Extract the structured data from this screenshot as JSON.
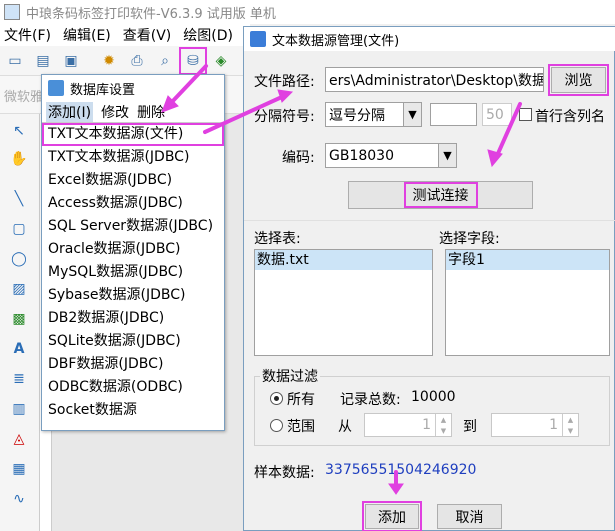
{
  "app": {
    "title": "中琅条码标签打印软件-V6.3.9 试用版 单机"
  },
  "menu": [
    "文件(F)",
    "编辑(E)",
    "查看(V)",
    "绘图(D)"
  ],
  "toolbar_hint": "微软雅",
  "db_settings": {
    "title": "数据库设置",
    "tabs": [
      "添加(I)",
      "修改",
      "删除"
    ],
    "items": [
      "TXT文本数据源(文件)",
      "TXT文本数据源(JDBC)",
      "Excel数据源(JDBC)",
      "Access数据源(JDBC)",
      "SQL Server数据源(JDBC)",
      "Oracle数据源(JDBC)",
      "MySQL数据源(JDBC)",
      "Sybase数据源(JDBC)",
      "DB2数据源(JDBC)",
      "SQLite数据源(JDBC)",
      "DBF数据源(JDBC)",
      "ODBC数据源(ODBC)",
      "Socket数据源"
    ],
    "selected_index": 0
  },
  "dialog": {
    "title": "文本数据源管理(文件)",
    "file_path_label": "文件路径:",
    "file_path_value": "ers\\Administrator\\Desktop\\数据.txt",
    "browse_label": "浏览",
    "separator_label": "分隔符号:",
    "separator_value": "逗号分隔",
    "separator_custom": "",
    "separator_num": "50",
    "first_row_label": "首行含列名",
    "encoding_label": "编码:",
    "encoding_value": "GB18030",
    "test_label": "测试连接",
    "select_table_label": "选择表:",
    "tables": [
      "数据.txt"
    ],
    "select_field_label": "选择字段:",
    "fields": [
      "字段1"
    ],
    "filter_label": "数据过滤",
    "all_label": "所有",
    "total_label": "记录总数:",
    "total_value": "10000",
    "range_label": "范围",
    "from_label": "从",
    "from_value": "1",
    "to_label": "到",
    "to_value": "1",
    "sample_label": "样本数据:",
    "sample_value": "33756551504246920",
    "add_label": "添加",
    "cancel_label": "取消"
  },
  "colors": {
    "highlight": "#e040e0",
    "sample_text": "#1f3fbf",
    "selection": "#cce4f7"
  }
}
